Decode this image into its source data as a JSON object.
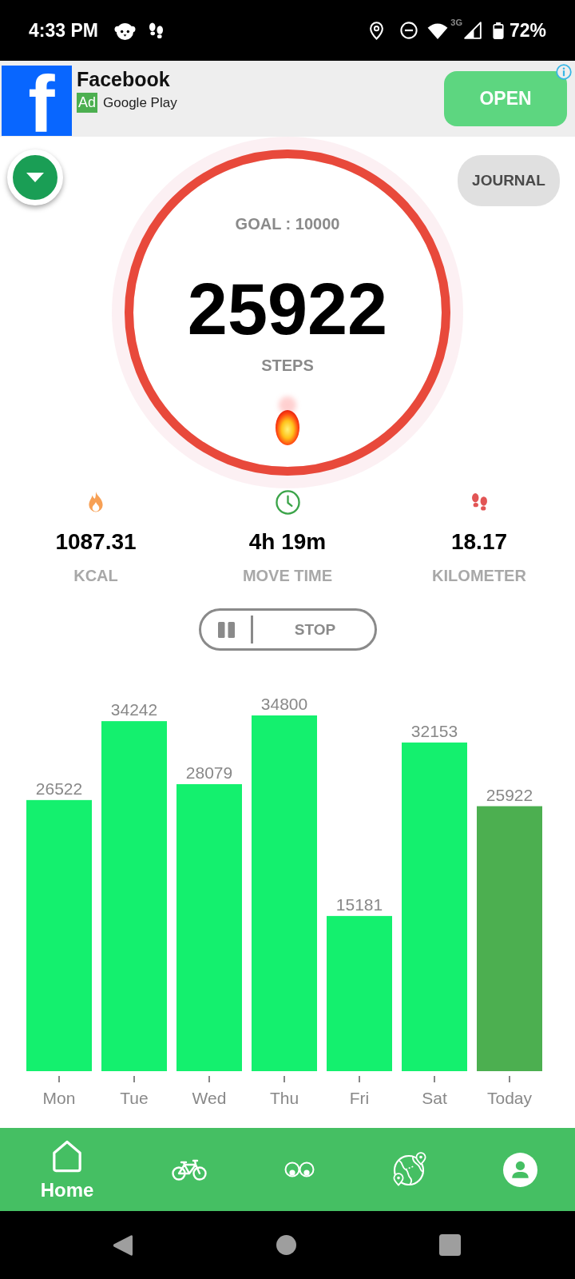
{
  "status_bar": {
    "time": "4:33 PM",
    "network": "3G",
    "battery": "72%"
  },
  "ad": {
    "logo": "f",
    "title": "Facebook",
    "tag": "Ad",
    "source": "Google Play",
    "button": "OPEN"
  },
  "header": {
    "journal_button": "JOURNAL"
  },
  "progress": {
    "goal": "GOAL : 10000",
    "steps": "25922",
    "unit": "STEPS",
    "level": 1
  },
  "stats": [
    {
      "kind": "calories",
      "value": "1087.31",
      "label": "KCAL"
    },
    {
      "kind": "time",
      "value": "4h 19m",
      "label": "MOVE TIME"
    },
    {
      "kind": "distance",
      "value": "18.17",
      "label": "KILOMETER"
    }
  ],
  "controls": {
    "stop_button": "STOP"
  },
  "chart": {
    "chart_data": {
      "type": "bar",
      "categories": [
        "Mon",
        "Tue",
        "Wed",
        "Thu",
        "Fri",
        "Sat",
        "Today"
      ],
      "series": [
        {
          "color": "#14f06e",
          "values": [
            26522,
            34242,
            28079,
            34800,
            15181,
            32153,
            null
          ]
        },
        {
          "color": "#4caf50",
          "values": [
            null,
            null,
            null,
            null,
            null,
            null,
            25922
          ]
        }
      ],
      "stacked": true,
      "data_labels": true
    }
  },
  "bottom_nav": [
    {
      "kind": "home",
      "label": "Home",
      "selected": true
    },
    {
      "kind": "bike",
      "selected": false
    },
    {
      "kind": "eyes",
      "selected": false
    },
    {
      "kind": "globe",
      "selected": false
    },
    {
      "kind": "profile",
      "selected": false
    }
  ]
}
